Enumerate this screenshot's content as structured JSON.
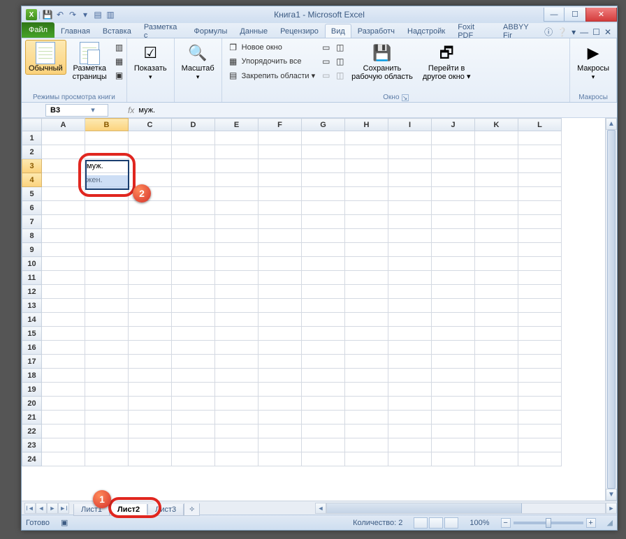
{
  "title": "Книга1  -  Microsoft Excel",
  "qat_icons": [
    "save",
    "undo",
    "redo",
    "qat-more",
    "doc",
    "doc2"
  ],
  "file_tab": "Файл",
  "ribbon_tabs": [
    "Главная",
    "Вставка",
    "Разметка с",
    "Формулы",
    "Данные",
    "Рецензиро",
    "Вид",
    "Разработч",
    "Надстройк",
    "Foxit PDF",
    "ABBYY Fir"
  ],
  "active_tab_index": 6,
  "help_icons": [
    "min-ribbon",
    "help"
  ],
  "ribbon": {
    "group_modes": {
      "big1": "Обычный",
      "big2": "Разметка\nстраницы",
      "label": "Режимы просмотра книги"
    },
    "group_show": {
      "big": "Показать",
      "label": ""
    },
    "group_zoom": {
      "big": "Масштаб",
      "label": ""
    },
    "group_window": {
      "items": [
        "Новое окно",
        "Упорядочить все",
        "Закрепить области ▾"
      ],
      "save": "Сохранить\nрабочую область",
      "goto": "Перейти в\nдругое окно ▾",
      "label": "Окно"
    },
    "group_macros": {
      "big": "Макросы",
      "label": "Макросы"
    }
  },
  "namebox": "B3",
  "formula_value": "муж.",
  "columns": [
    "A",
    "B",
    "C",
    "D",
    "E",
    "F",
    "G",
    "H",
    "I",
    "J",
    "K",
    "L"
  ],
  "rows_count": 24,
  "cells": {
    "B3": "муж.",
    "B4": "жен."
  },
  "selected_cols": [
    "B"
  ],
  "selected_rows": [
    3,
    4
  ],
  "sheet_tabs": [
    "Лист1",
    "Лист2",
    "Лист3"
  ],
  "active_sheet_index": 1,
  "status_ready": "Готово",
  "status_count_label": "Количество: 2",
  "zoom_label": "100%",
  "annotations": {
    "marker1": "1",
    "marker2": "2"
  }
}
